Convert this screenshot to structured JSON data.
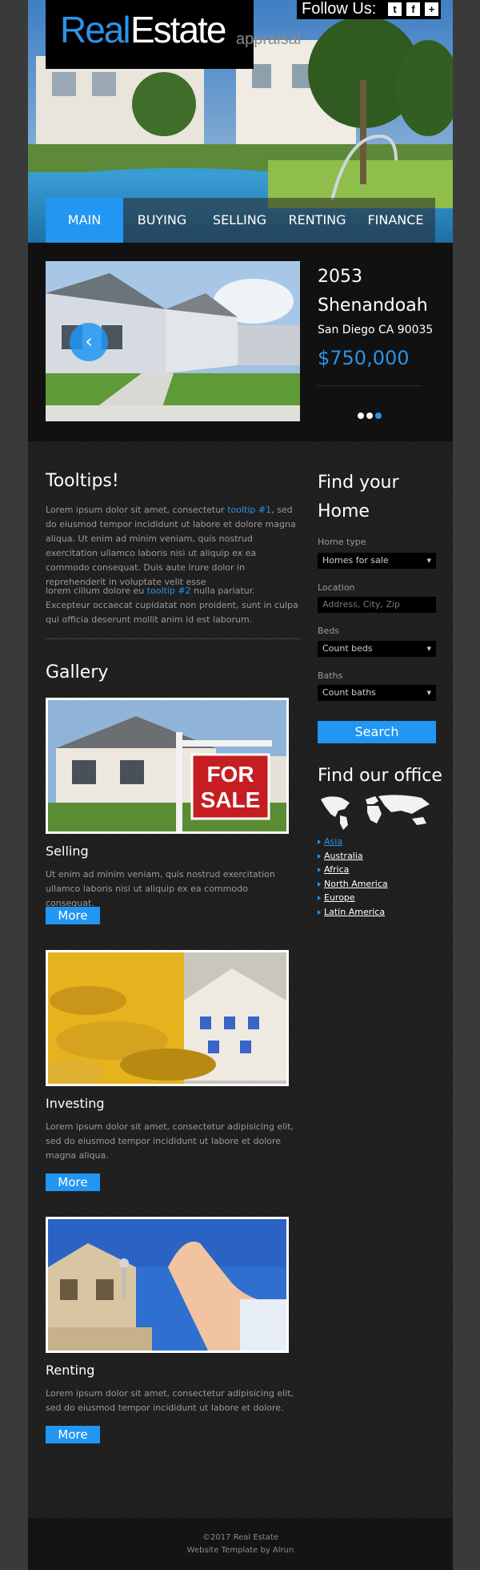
{
  "logo": {
    "part1": "Real",
    "part2": "Estate",
    "part3": "appraisal"
  },
  "follow": {
    "label": "Follow Us:",
    "icons": [
      "twitter-icon",
      "facebook-icon",
      "plus-icon"
    ],
    "glyphs": [
      "t",
      "f",
      "+"
    ]
  },
  "nav": {
    "items": [
      "MAIN",
      "BUYING",
      "SELLING",
      "RENTING",
      "FINANCE"
    ],
    "active": "MAIN"
  },
  "feature": {
    "address": "2053 Shenandoah",
    "city": "San Diego CA 90035",
    "price": "$750,000",
    "prev_arrow": "‹",
    "slides": 3,
    "active_slide": 3
  },
  "tooltips": {
    "title": "Tooltips!",
    "p1_a": "Lorem ipsum dolor sit amet, consectetur ",
    "p1_link": "tooltip #1",
    "p1_b": ", sed do eiusmod tempor incididunt ut labore et dolore magna aliqua. Ut enim ad minim veniam, quis nostrud exercitation ullamco laboris nisi ut aliquip ex ea commodo consequat. Duis aute irure dolor in reprehenderit in voluptate velit esse",
    "p2_a": "lorem cillum dolore eu ",
    "p2_link": "tooltip #2",
    "p2_b": " nulla pariatur. Excepteur occaecat cupidatat non proident, sunt in culpa qui officia deserunt mollit anim id est laborum."
  },
  "gallery": {
    "title": "Gallery",
    "items": [
      {
        "title": "Selling",
        "text": "Ut enim ad minim veniam, quis nostrud exercitation ullamco laboris nisi ut aliquip ex ea commodo consequat.",
        "button": "More",
        "sign_line1": "FOR",
        "sign_line2": "SALE"
      },
      {
        "title": "Investing",
        "text": "Lorem ipsum dolor sit amet, consectetur adipisicing elit, sed do eiusmod tempor incididunt ut labore et dolore magna aliqua.",
        "button": "More"
      },
      {
        "title": "Renting",
        "text": "Lorem ipsum dolor sit amet, consectetur adipisicing elit, sed do eiusmod tempor incididunt ut labore et dolore.",
        "button": "More"
      }
    ]
  },
  "search": {
    "title": "Find your Home",
    "home_type_label": "Home type",
    "home_type_value": "Homes for sale",
    "location_label": "Location",
    "location_placeholder": "Address, City, Zip",
    "beds_label": "Beds",
    "beds_value": "Count beds",
    "baths_label": "Baths",
    "baths_value": "Count baths",
    "button": "Search"
  },
  "office": {
    "title": "Find our office",
    "regions": [
      "Asia",
      "Australia",
      "Africa",
      "North America",
      "Europe",
      "Latin America"
    ]
  },
  "footer": {
    "line1": "©2017 Real Estate",
    "line2": "Website Template by Alrun"
  },
  "colors": {
    "accent": "#2196f3",
    "background": "#1e1e1e",
    "dark": "#111111"
  }
}
